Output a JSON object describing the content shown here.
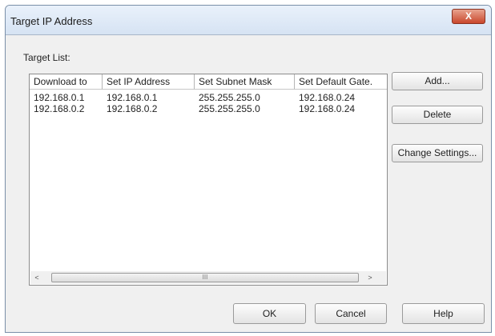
{
  "window": {
    "title": "Target IP Address",
    "close_label": "X"
  },
  "target_list": {
    "label": "Target List:",
    "columns": [
      "Download to",
      "Set IP Address",
      "Set Subnet Mask",
      "Set Default Gate."
    ],
    "rows": [
      [
        "192.168.0.1",
        "192.168.0.1",
        "255.255.255.0",
        "192.168.0.24"
      ],
      [
        "192.168.0.2",
        "192.168.0.2",
        "255.255.255.0",
        "192.168.0.24"
      ]
    ],
    "scrollbar": {
      "left_arrow": "<",
      "right_arrow": ">",
      "thumb_grip": "III"
    }
  },
  "side_buttons": {
    "add": "Add...",
    "delete": "Delete",
    "change_settings": "Change Settings..."
  },
  "bottom_buttons": {
    "ok": "OK",
    "cancel": "Cancel",
    "help": "Help"
  }
}
